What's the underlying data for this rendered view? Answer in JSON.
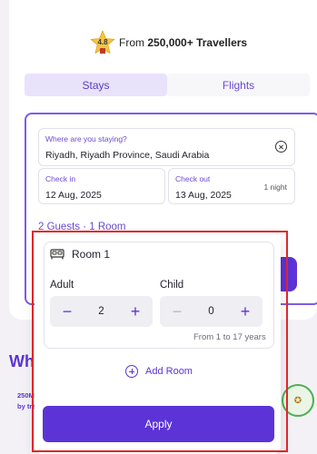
{
  "rating": {
    "score": "4.8",
    "prefix": "From ",
    "highlight": "250,000+ Travellers"
  },
  "tabs": [
    {
      "label": "Stays",
      "active": true
    },
    {
      "label": "Flights",
      "active": false
    }
  ],
  "search": {
    "where_label": "Where are you staying?",
    "where_value": "Riyadh, Riyadh Province, Saudi Arabia",
    "checkin_label": "Check in",
    "checkin_value": "12 Aug, 2025",
    "checkout_label": "Check out",
    "checkout_value": "13 Aug, 2025",
    "nights": "1 night",
    "guests_summary": "2 Guests · 1 Room"
  },
  "background": {
    "why_heading": "Why",
    "stat_line1": "250M",
    "stat_line2": "by tra"
  },
  "popup": {
    "room_title": "Room 1",
    "adult_label": "Adult",
    "adult_count": "2",
    "child_label": "Child",
    "child_count": "0",
    "minus_symbol": "−",
    "plus_symbol": "+",
    "age_note": "From 1 to 17 years",
    "add_room_label": "Add Room",
    "apply_label": "Apply"
  },
  "colors": {
    "accent": "#5b33d6",
    "accent_light": "#e9e2fb",
    "highlight_outline": "#e0262c"
  }
}
